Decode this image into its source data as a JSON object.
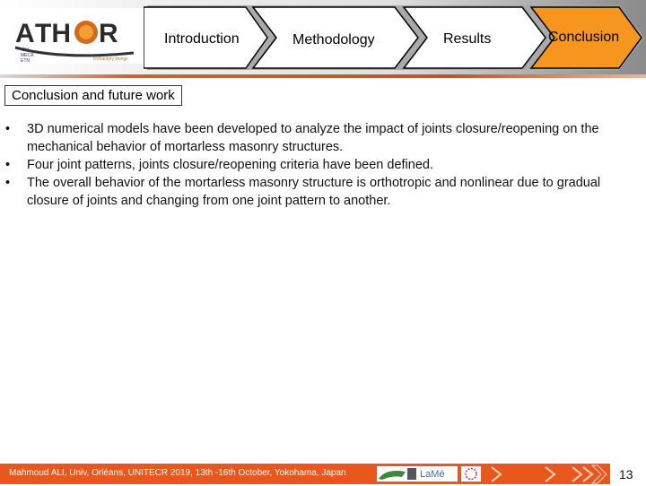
{
  "header": {
    "logo": {
      "name": "ATHOR",
      "subtext_left": [
        "EU",
        "MECA",
        "ETN"
      ],
      "subtext_right": "Refractory linings"
    },
    "nav_steps": [
      {
        "label": "Introduction",
        "active": false
      },
      {
        "label": "Methodology",
        "active": false
      },
      {
        "label": "Results",
        "active": false
      },
      {
        "label": "Conclusion",
        "active": true
      }
    ],
    "active_color": "#f7961f"
  },
  "section_title": "Conclusion and future work",
  "bullets": [
    {
      "marker": "•",
      "text": "3D numerical models have been developed to analyze the impact of joints closure/reopening on the mechanical behavior of mortarless masonry structures."
    },
    {
      "marker": "•",
      "text": "Four joint patterns, joints closure/reopening criteria have been defined."
    },
    {
      "marker": "•",
      "text": "The overall behavior of the mortarless masonry structure is orthotropic and nonlinear due to gradual closure of joints and changing from one joint pattern to another."
    }
  ],
  "footer": {
    "text": "Mahmoud ALI, Univ, Orléans, UNITECR 2019, 13th -16th October, Yokohama, Japan",
    "partner_logos": [
      "partner-logo-1",
      "LaMé",
      "partner-logo-3"
    ],
    "page_number": "13",
    "bar_color": "#e8571b"
  }
}
